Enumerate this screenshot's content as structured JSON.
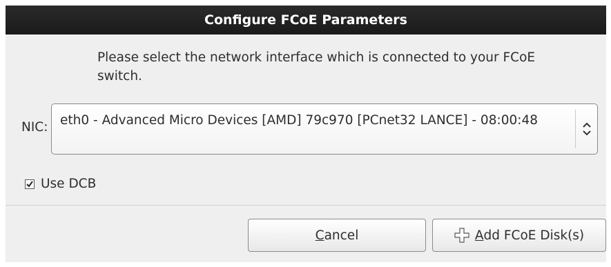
{
  "window": {
    "title": "Configure FCoE Parameters"
  },
  "message": "Please select the network interface which is connected to your FCoE switch.",
  "nic": {
    "label": "NIC:",
    "selected_value": "eth0 - Advanced Micro Devices [AMD] 79c970 [PCnet32 LANCE] - 08:00:48"
  },
  "use_dcb": {
    "label": "Use DCB",
    "checked": true
  },
  "buttons": {
    "cancel": {
      "mnemonic": "C",
      "rest": "ancel"
    },
    "add": {
      "mnemonic": "A",
      "rest": "dd FCoE Disk(s)"
    }
  },
  "icons": {
    "nic_combo_arrow": "chevron-up-down-icon",
    "add_button": "plus-icon",
    "dcb_check": "checkmark-icon"
  }
}
